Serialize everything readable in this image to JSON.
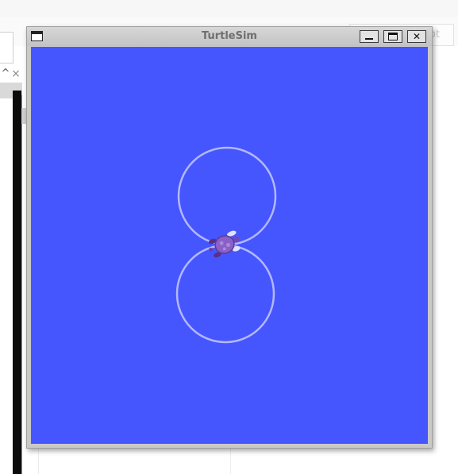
{
  "background": {
    "tab_fragment_text": "ot",
    "close_glyph": "×",
    "caret_glyph": "^"
  },
  "window": {
    "title": "TurtleSim",
    "controls": {
      "minimize": "",
      "maximize": "",
      "close": "✕"
    }
  },
  "canvas": {
    "background_color": "#4556ff",
    "trail_color": "#b3b8ff",
    "turtle_color": "#8a5fc7"
  }
}
